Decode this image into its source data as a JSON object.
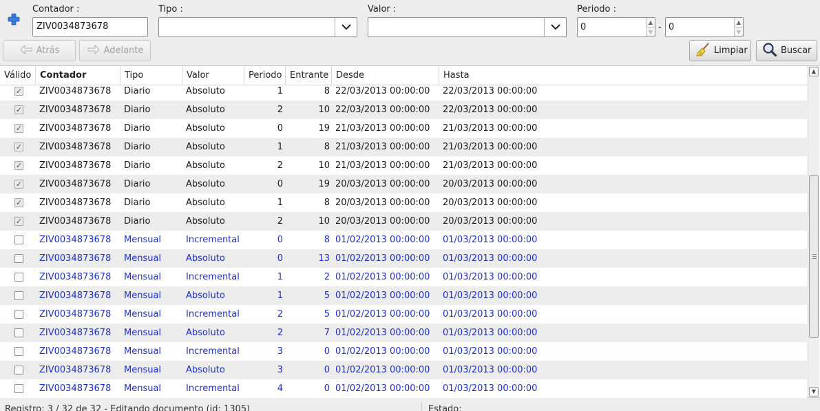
{
  "filters": {
    "contador_label": "Contador :",
    "contador_value": "ZIV0034873678",
    "tipo_label": "Tipo :",
    "tipo_value": "",
    "valor_label": "Valor :",
    "valor_value": "",
    "periodo_label": "Periodo :",
    "periodo_from": "0",
    "periodo_to": "0",
    "periodo_sep": "-"
  },
  "toolbar": {
    "back_label": "Atrás",
    "forward_label": "Adelante",
    "clear_label": "Limpiar",
    "search_label": "Buscar"
  },
  "table": {
    "columns": [
      "Válido",
      "Contador",
      "Tipo",
      "Valor",
      "Periodo",
      "Entrante",
      "Desde",
      "Hasta"
    ],
    "rows": [
      {
        "valido": true,
        "contador": "ZIV0034873678",
        "tipo": "Diario",
        "valor": "Absoluto",
        "periodo": "1",
        "entrante": "8",
        "desde": "22/03/2013 00:00:00",
        "hasta": "22/03/2013 00:00:00"
      },
      {
        "valido": true,
        "contador": "ZIV0034873678",
        "tipo": "Diario",
        "valor": "Absoluto",
        "periodo": "2",
        "entrante": "10",
        "desde": "22/03/2013 00:00:00",
        "hasta": "22/03/2013 00:00:00"
      },
      {
        "valido": true,
        "contador": "ZIV0034873678",
        "tipo": "Diario",
        "valor": "Absoluto",
        "periodo": "0",
        "entrante": "19",
        "desde": "21/03/2013 00:00:00",
        "hasta": "21/03/2013 00:00:00"
      },
      {
        "valido": true,
        "contador": "ZIV0034873678",
        "tipo": "Diario",
        "valor": "Absoluto",
        "periodo": "1",
        "entrante": "8",
        "desde": "21/03/2013 00:00:00",
        "hasta": "21/03/2013 00:00:00"
      },
      {
        "valido": true,
        "contador": "ZIV0034873678",
        "tipo": "Diario",
        "valor": "Absoluto",
        "periodo": "2",
        "entrante": "10",
        "desde": "21/03/2013 00:00:00",
        "hasta": "21/03/2013 00:00:00"
      },
      {
        "valido": true,
        "contador": "ZIV0034873678",
        "tipo": "Diario",
        "valor": "Absoluto",
        "periodo": "0",
        "entrante": "19",
        "desde": "20/03/2013 00:00:00",
        "hasta": "20/03/2013 00:00:00"
      },
      {
        "valido": true,
        "contador": "ZIV0034873678",
        "tipo": "Diario",
        "valor": "Absoluto",
        "periodo": "1",
        "entrante": "8",
        "desde": "20/03/2013 00:00:00",
        "hasta": "20/03/2013 00:00:00"
      },
      {
        "valido": true,
        "contador": "ZIV0034873678",
        "tipo": "Diario",
        "valor": "Absoluto",
        "periodo": "2",
        "entrante": "10",
        "desde": "20/03/2013 00:00:00",
        "hasta": "20/03/2013 00:00:00"
      },
      {
        "valido": false,
        "contador": "ZIV0034873678",
        "tipo": "Mensual",
        "valor": "Incremental",
        "periodo": "0",
        "entrante": "8",
        "desde": "01/02/2013 00:00:00",
        "hasta": "01/03/2013 00:00:00"
      },
      {
        "valido": false,
        "contador": "ZIV0034873678",
        "tipo": "Mensual",
        "valor": "Absoluto",
        "periodo": "0",
        "entrante": "13",
        "desde": "01/02/2013 00:00:00",
        "hasta": "01/03/2013 00:00:00"
      },
      {
        "valido": false,
        "contador": "ZIV0034873678",
        "tipo": "Mensual",
        "valor": "Incremental",
        "periodo": "1",
        "entrante": "2",
        "desde": "01/02/2013 00:00:00",
        "hasta": "01/03/2013 00:00:00"
      },
      {
        "valido": false,
        "contador": "ZIV0034873678",
        "tipo": "Mensual",
        "valor": "Absoluto",
        "periodo": "1",
        "entrante": "5",
        "desde": "01/02/2013 00:00:00",
        "hasta": "01/03/2013 00:00:00"
      },
      {
        "valido": false,
        "contador": "ZIV0034873678",
        "tipo": "Mensual",
        "valor": "Incremental",
        "periodo": "2",
        "entrante": "5",
        "desde": "01/02/2013 00:00:00",
        "hasta": "01/03/2013 00:00:00"
      },
      {
        "valido": false,
        "contador": "ZIV0034873678",
        "tipo": "Mensual",
        "valor": "Absoluto",
        "periodo": "2",
        "entrante": "7",
        "desde": "01/02/2013 00:00:00",
        "hasta": "01/03/2013 00:00:00"
      },
      {
        "valido": false,
        "contador": "ZIV0034873678",
        "tipo": "Mensual",
        "valor": "Incremental",
        "periodo": "3",
        "entrante": "0",
        "desde": "01/02/2013 00:00:00",
        "hasta": "01/03/2013 00:00:00"
      },
      {
        "valido": false,
        "contador": "ZIV0034873678",
        "tipo": "Mensual",
        "valor": "Absoluto",
        "periodo": "3",
        "entrante": "0",
        "desde": "01/02/2013 00:00:00",
        "hasta": "01/03/2013 00:00:00"
      },
      {
        "valido": false,
        "contador": "ZIV0034873678",
        "tipo": "Mensual",
        "valor": "Incremental",
        "periodo": "4",
        "entrante": "0",
        "desde": "01/02/2013 00:00:00",
        "hasta": "01/03/2013 00:00:00"
      }
    ]
  },
  "status": {
    "left": "Registro: 3 / 32 de 32 - Editando documento (id: 1305)",
    "right": "Estado:"
  },
  "colors": {
    "invalid_row_text": "#1c2fd6",
    "add_icon": "#2a6fd6"
  },
  "icons": {
    "add": "plus-icon",
    "back": "arrow-left-icon",
    "forward": "arrow-right-icon",
    "clear": "broom-icon",
    "search": "magnifier-icon"
  }
}
